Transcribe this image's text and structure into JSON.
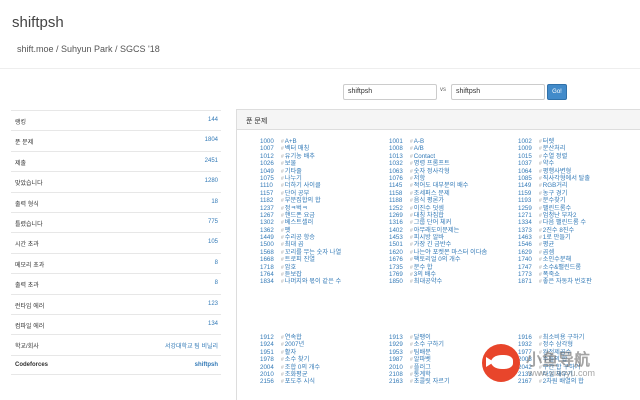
{
  "header": {
    "title": "shiftpsh",
    "subtitle": "shift.moe / Suhyun Park / SGCS '18"
  },
  "compare": {
    "left_value": "shiftpsh",
    "vs_label": "vs",
    "right_value": "shiftpsh",
    "go_label": "Go!"
  },
  "stats": [
    {
      "label": "랭킹",
      "value": "144"
    },
    {
      "label": "푼 문제",
      "value": "1804"
    },
    {
      "label": "제출",
      "value": "2451"
    },
    {
      "label": "맞았습니다",
      "value": "1280"
    },
    {
      "label": "출력 형식",
      "value": "18"
    },
    {
      "label": "틀렸습니다",
      "value": "775"
    },
    {
      "label": "시간 초과",
      "value": "105"
    },
    {
      "label": "메모리 초과",
      "value": "8"
    },
    {
      "label": "출력 초과",
      "value": "8"
    },
    {
      "label": "런타임 에러",
      "value": "123"
    },
    {
      "label": "컴파일 에러",
      "value": "134"
    },
    {
      "label": "학교/회사",
      "value": "서강대학교 팀 비닐리"
    },
    {
      "label": "Codeforces",
      "value": "shiftpsh"
    }
  ],
  "panel": {
    "heading": "푼 문제"
  },
  "problems": {
    "col1": [
      {
        "num": "1000",
        "title": "A+B"
      },
      {
        "num": "1007",
        "title": "벡터 매칭"
      },
      {
        "num": "1012",
        "title": "유기농 배추"
      },
      {
        "num": "1026",
        "title": "보물"
      },
      {
        "num": "1049",
        "title": "기타줄"
      },
      {
        "num": "1075",
        "title": "나누기"
      },
      {
        "num": "1110",
        "title": "더하기 사이클"
      },
      {
        "num": "1157",
        "title": "단어 공부"
      },
      {
        "num": "1182",
        "title": "부분집합의 합"
      },
      {
        "num": "1237",
        "title": "정ㅋ벅ㅋ"
      },
      {
        "num": "1267",
        "title": "핸드폰 요금"
      },
      {
        "num": "1302",
        "title": "베스트셀러"
      },
      {
        "num": "1362",
        "title": "펫"
      },
      {
        "num": "1449",
        "title": "수리공 항승"
      },
      {
        "num": "1500",
        "title": "최대 곱"
      },
      {
        "num": "1568",
        "title": "꼬리를 무는 숫자 나열"
      },
      {
        "num": "1668",
        "title": "트로피 진열"
      },
      {
        "num": "1718",
        "title": "암호"
      },
      {
        "num": "1764",
        "title": "듣보잡"
      },
      {
        "num": "1834",
        "title": "나머지와 몫이 같은 수"
      }
    ],
    "col2": [
      {
        "num": "1001",
        "title": "A-B"
      },
      {
        "num": "1008",
        "title": "A/B"
      },
      {
        "num": "1013",
        "title": "Contact"
      },
      {
        "num": "1032",
        "title": "명령 프롬프트"
      },
      {
        "num": "1063",
        "title": "숫자 정사각형"
      },
      {
        "num": "1076",
        "title": "저항"
      },
      {
        "num": "1145",
        "title": "적어도 대부분의 배수"
      },
      {
        "num": "1158",
        "title": "조세퍼스 문제"
      },
      {
        "num": "1188",
        "title": "음식 평론가"
      },
      {
        "num": "1252",
        "title": "이진수 덧셈"
      },
      {
        "num": "1269",
        "title": "대칭 차집합"
      },
      {
        "num": "1316",
        "title": "그룹 단어 체커"
      },
      {
        "num": "1402",
        "title": "아무래도이문제는"
      },
      {
        "num": "1453",
        "title": "피시방 알바"
      },
      {
        "num": "1501",
        "title": "가장 긴 금반수"
      },
      {
        "num": "1620",
        "title": "나는야 포켓몬 마스터 이다솜"
      },
      {
        "num": "1676",
        "title": "팩토리얼 0의 개수"
      },
      {
        "num": "1735",
        "title": "분수 합"
      },
      {
        "num": "1769",
        "title": "3의 배수"
      },
      {
        "num": "1850",
        "title": "최대공약수"
      }
    ],
    "col3": [
      {
        "num": "1002",
        "title": "터렛"
      },
      {
        "num": "1009",
        "title": "분산처리"
      },
      {
        "num": "1015",
        "title": "수열 정렬"
      },
      {
        "num": "1037",
        "title": "약수"
      },
      {
        "num": "1064",
        "title": "평행사변형"
      },
      {
        "num": "1085",
        "title": "직사각형에서 탈출"
      },
      {
        "num": "1149",
        "title": "RGB거리"
      },
      {
        "num": "1159",
        "title": "농구 경기"
      },
      {
        "num": "1193",
        "title": "분수찾기"
      },
      {
        "num": "1259",
        "title": "팰린드롬수"
      },
      {
        "num": "1271",
        "title": "엄청난 부자2"
      },
      {
        "num": "1334",
        "title": "다음 팰린드롬 수"
      },
      {
        "num": "1373",
        "title": "2진수 8진수"
      },
      {
        "num": "1463",
        "title": "1로 만들기"
      },
      {
        "num": "1546",
        "title": "평균"
      },
      {
        "num": "1629",
        "title": "곱셈"
      },
      {
        "num": "1740",
        "title": "소인수분해"
      },
      {
        "num": "1747",
        "title": "소수&팰린드롬"
      },
      {
        "num": "1773",
        "title": "폭죽쇼"
      },
      {
        "num": "1871",
        "title": "좋은 자동차 번호판"
      }
    ],
    "col4": [
      {
        "num": "1912",
        "title": "연속합"
      },
      {
        "num": "1924",
        "title": "2007년"
      },
      {
        "num": "1951",
        "title": "활자"
      },
      {
        "num": "1978",
        "title": "소수 찾기"
      },
      {
        "num": "2004",
        "title": "조합 0의 개수"
      },
      {
        "num": "2010",
        "title": "조화평균"
      },
      {
        "num": "2156",
        "title": "포도주 시식"
      }
    ],
    "col5": [
      {
        "num": "1913",
        "title": "달팽이"
      },
      {
        "num": "1929",
        "title": "소수 구하기"
      },
      {
        "num": "1953",
        "title": "팀배분"
      },
      {
        "num": "1987",
        "title": "알파벳"
      },
      {
        "num": "2010",
        "title": "플러그"
      },
      {
        "num": "2108",
        "title": "통계학"
      },
      {
        "num": "2163",
        "title": "초콜릿 자르기"
      }
    ],
    "col6": [
      {
        "num": "1916",
        "title": "최소비용 구하기"
      },
      {
        "num": "1932",
        "title": "정수 삼각형"
      },
      {
        "num": "1977",
        "title": "완전제곱수"
      },
      {
        "num": "2003",
        "title": "수들의 합"
      },
      {
        "num": "2042",
        "title": "구간 합 구하기"
      },
      {
        "num": "2133",
        "title": "타일 채우기"
      },
      {
        "num": "2167",
        "title": "2차원 배열의 합"
      }
    ]
  },
  "watermark": {
    "text": "小鱼导航",
    "url": "www.xiaoyu.com"
  }
}
